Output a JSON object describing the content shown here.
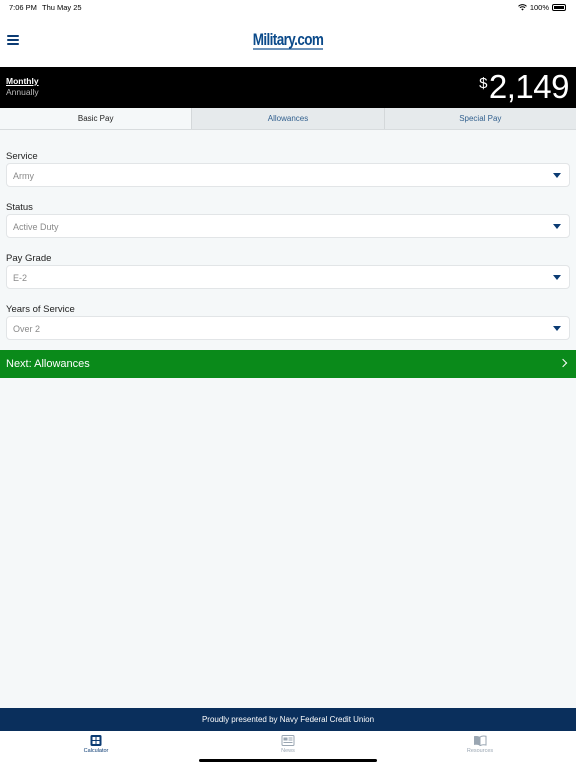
{
  "status_bar": {
    "time": "7:06 PM",
    "date": "Thu May 25",
    "battery": "100%"
  },
  "header": {
    "logo_text": "Military.com"
  },
  "pay": {
    "period_monthly": "Monthly",
    "period_annually": "Annually",
    "currency": "$",
    "amount": "2,149"
  },
  "tabs": [
    {
      "label": "Basic Pay",
      "active": true
    },
    {
      "label": "Allowances",
      "active": false
    },
    {
      "label": "Special Pay",
      "active": false
    }
  ],
  "form": {
    "service": {
      "label": "Service",
      "value": "Army"
    },
    "status": {
      "label": "Status",
      "value": "Active Duty"
    },
    "pay_grade": {
      "label": "Pay Grade",
      "value": "E-2"
    },
    "years": {
      "label": "Years of Service",
      "value": "Over 2"
    }
  },
  "next_button": {
    "label": "Next: Allowances"
  },
  "sponsor": {
    "text": "Proudly presented by Navy Federal Credit Union"
  },
  "bottom_nav": [
    {
      "label": "Calculator",
      "icon": "calculator-icon",
      "active": true
    },
    {
      "label": "News",
      "icon": "news-icon",
      "active": false
    },
    {
      "label": "Resources",
      "icon": "book-icon",
      "active": false
    }
  ],
  "colors": {
    "brand_navy": "#0a2f5c",
    "next_green": "#0a8a1a",
    "pay_bar_bg": "#000000"
  }
}
